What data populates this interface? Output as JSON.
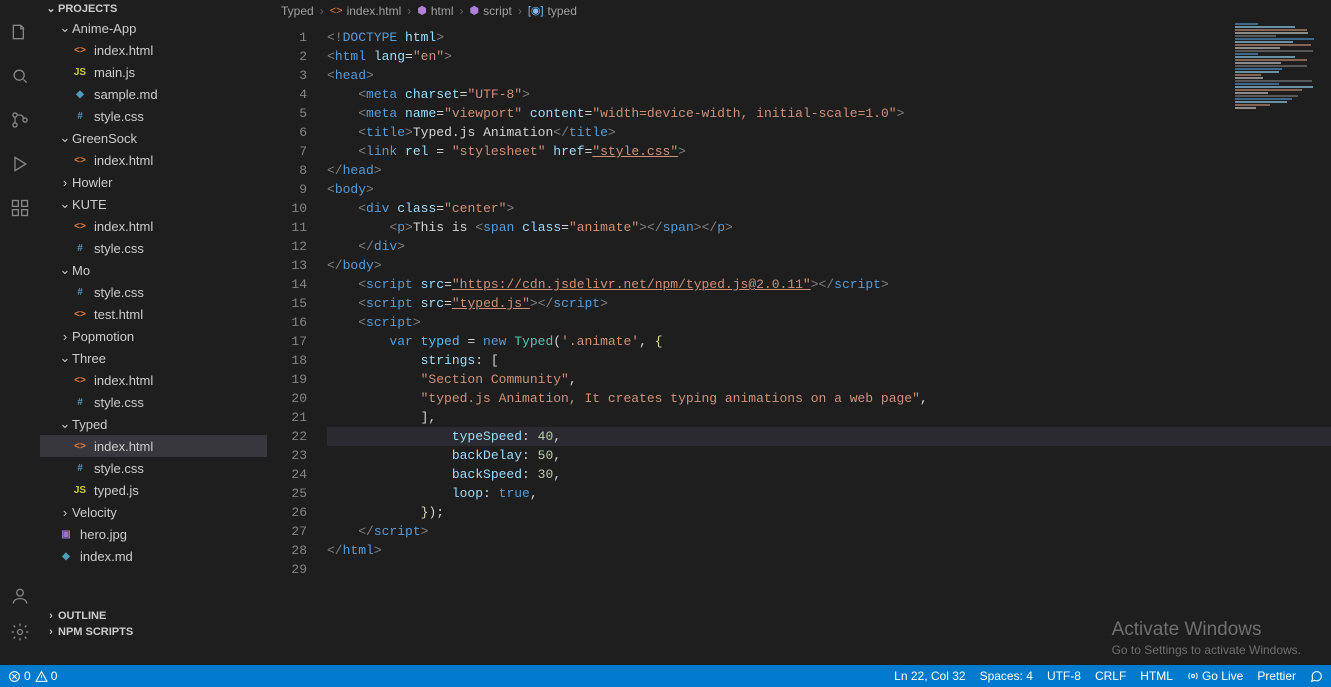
{
  "sidebar": {
    "projects_label": "PROJECTS",
    "folders": [
      {
        "name": "Anime-App",
        "expanded": true,
        "files": [
          {
            "name": "index.html",
            "type": "html"
          },
          {
            "name": "main.js",
            "type": "js"
          },
          {
            "name": "sample.md",
            "type": "md"
          },
          {
            "name": "style.css",
            "type": "css"
          }
        ]
      },
      {
        "name": "GreenSock",
        "expanded": true,
        "files": [
          {
            "name": "index.html",
            "type": "html"
          }
        ]
      },
      {
        "name": "Howler",
        "expanded": false,
        "files": []
      },
      {
        "name": "KUTE",
        "expanded": true,
        "files": [
          {
            "name": "index.html",
            "type": "html"
          },
          {
            "name": "style.css",
            "type": "css"
          }
        ]
      },
      {
        "name": "Mo",
        "expanded": true,
        "files": [
          {
            "name": "style.css",
            "type": "css"
          },
          {
            "name": "test.html",
            "type": "html"
          }
        ]
      },
      {
        "name": "Popmotion",
        "expanded": false,
        "files": []
      },
      {
        "name": "Three",
        "expanded": true,
        "files": [
          {
            "name": "index.html",
            "type": "html"
          },
          {
            "name": "style.css",
            "type": "css"
          }
        ]
      },
      {
        "name": "Typed",
        "expanded": true,
        "active_file": "index.html",
        "files": [
          {
            "name": "index.html",
            "type": "html"
          },
          {
            "name": "style.css",
            "type": "css"
          },
          {
            "name": "typed.js",
            "type": "js"
          }
        ]
      },
      {
        "name": "Velocity",
        "expanded": false,
        "files": []
      }
    ],
    "root_files": [
      {
        "name": "hero.jpg",
        "type": "img"
      },
      {
        "name": "index.md",
        "type": "md"
      }
    ],
    "outline_label": "OUTLINE",
    "npm_label": "NPM SCRIPTS"
  },
  "breadcrumbs": [
    "Typed",
    "index.html",
    "html",
    "script",
    "typed"
  ],
  "editor": {
    "lines": 29,
    "highlight_line": 22,
    "code": [
      {
        "t": [
          [
            "gray",
            "<!"
          ],
          [
            "blue",
            "DOCTYPE"
          ],
          [
            "lightblue",
            " html"
          ],
          [
            "gray",
            ">"
          ]
        ]
      },
      {
        "t": [
          [
            "gray",
            "<"
          ],
          [
            "blue",
            "html"
          ],
          [
            "lightblue",
            " lang"
          ],
          [
            "white",
            "="
          ],
          [
            "string",
            "\"en\""
          ],
          [
            "gray",
            ">"
          ]
        ]
      },
      {
        "t": [
          [
            "gray",
            "<"
          ],
          [
            "blue",
            "head"
          ],
          [
            "gray",
            ">"
          ]
        ]
      },
      {
        "i": 1,
        "t": [
          [
            "gray",
            "<"
          ],
          [
            "blue",
            "meta"
          ],
          [
            "lightblue",
            " charset"
          ],
          [
            "white",
            "="
          ],
          [
            "string",
            "\"UTF-8\""
          ],
          [
            "gray",
            ">"
          ]
        ]
      },
      {
        "i": 1,
        "t": [
          [
            "gray",
            "<"
          ],
          [
            "blue",
            "meta"
          ],
          [
            "lightblue",
            " name"
          ],
          [
            "white",
            "="
          ],
          [
            "string",
            "\"viewport\""
          ],
          [
            "lightblue",
            " content"
          ],
          [
            "white",
            "="
          ],
          [
            "string",
            "\"width=device-width, initial-scale=1.0\""
          ],
          [
            "gray",
            ">"
          ]
        ]
      },
      {
        "i": 1,
        "t": [
          [
            "gray",
            "<"
          ],
          [
            "blue",
            "title"
          ],
          [
            "gray",
            ">"
          ],
          [
            "white",
            "Typed.js Animation"
          ],
          [
            "gray",
            "</"
          ],
          [
            "blue",
            "title"
          ],
          [
            "gray",
            ">"
          ]
        ]
      },
      {
        "i": 1,
        "t": [
          [
            "gray",
            "<"
          ],
          [
            "blue",
            "link"
          ],
          [
            "lightblue",
            " rel"
          ],
          [
            "white",
            " = "
          ],
          [
            "string",
            "\"stylesheet\""
          ],
          [
            "lightblue",
            " href"
          ],
          [
            "white",
            "="
          ],
          [
            "link",
            "\"style.css\""
          ],
          [
            "gray",
            ">"
          ]
        ]
      },
      {
        "t": [
          [
            "gray",
            "</"
          ],
          [
            "blue",
            "head"
          ],
          [
            "gray",
            ">"
          ]
        ]
      },
      {
        "t": [
          [
            "gray",
            "<"
          ],
          [
            "blue",
            "body"
          ],
          [
            "gray",
            ">"
          ]
        ]
      },
      {
        "i": 1,
        "t": [
          [
            "gray",
            "<"
          ],
          [
            "blue",
            "div"
          ],
          [
            "lightblue",
            " class"
          ],
          [
            "white",
            "="
          ],
          [
            "string",
            "\"center\""
          ],
          [
            "gray",
            ">"
          ]
        ]
      },
      {
        "i": 2,
        "t": [
          [
            "gray",
            "<"
          ],
          [
            "blue",
            "p"
          ],
          [
            "gray",
            ">"
          ],
          [
            "white",
            "This is "
          ],
          [
            "gray",
            "<"
          ],
          [
            "blue",
            "span"
          ],
          [
            "lightblue",
            " class"
          ],
          [
            "white",
            "="
          ],
          [
            "string",
            "\"animate\""
          ],
          [
            "gray",
            "></"
          ],
          [
            "blue",
            "span"
          ],
          [
            "gray",
            "></"
          ],
          [
            "blue",
            "p"
          ],
          [
            "gray",
            ">"
          ]
        ]
      },
      {
        "i": 1,
        "t": [
          [
            "gray",
            "</"
          ],
          [
            "blue",
            "div"
          ],
          [
            "gray",
            ">"
          ]
        ]
      },
      {
        "t": [
          [
            "gray",
            "</"
          ],
          [
            "blue",
            "body"
          ],
          [
            "gray",
            ">"
          ]
        ]
      },
      {
        "i": 1,
        "t": [
          [
            "gray",
            "<"
          ],
          [
            "blue",
            "script"
          ],
          [
            "lightblue",
            " src"
          ],
          [
            "white",
            "="
          ],
          [
            "link",
            "\"https://cdn.jsdelivr.net/npm/typed.js@2.0.11\""
          ],
          [
            "gray",
            "></"
          ],
          [
            "blue",
            "script"
          ],
          [
            "gray",
            ">"
          ]
        ]
      },
      {
        "i": 1,
        "t": [
          [
            "gray",
            "<"
          ],
          [
            "blue",
            "script"
          ],
          [
            "lightblue",
            " src"
          ],
          [
            "white",
            "="
          ],
          [
            "link",
            "\"typed.js\""
          ],
          [
            "gray",
            "></"
          ],
          [
            "blue",
            "script"
          ],
          [
            "gray",
            ">"
          ]
        ]
      },
      {
        "i": 1,
        "t": [
          [
            "gray",
            "<"
          ],
          [
            "blue",
            "script"
          ],
          [
            "gray",
            ">"
          ]
        ]
      },
      {
        "i": 2,
        "t": [
          [
            "blue",
            "var"
          ],
          [
            "var",
            " typed"
          ],
          [
            "white",
            " = "
          ],
          [
            "blue",
            "new"
          ],
          [
            "green",
            " Typed"
          ],
          [
            "white",
            "("
          ],
          [
            "string",
            "'.animate'"
          ],
          [
            "white",
            ", "
          ],
          [
            "dyellow",
            "{"
          ]
        ]
      },
      {
        "i": 3,
        "t": [
          [
            "lightblue",
            "strings"
          ],
          [
            "white",
            ": "
          ],
          [
            "white",
            "["
          ]
        ]
      },
      {
        "i": 3,
        "t": [
          [
            "string",
            "\"Section Community\""
          ],
          [
            "white",
            ","
          ]
        ]
      },
      {
        "i": 3,
        "t": [
          [
            "string",
            "\"typed.js Animation, It creates typing animations on a web page\""
          ],
          [
            "white",
            ","
          ]
        ]
      },
      {
        "i": 3,
        "t": [
          [
            "white",
            "],"
          ]
        ]
      },
      {
        "i": 4,
        "t": [
          [
            "lightblue",
            "typeSpeed"
          ],
          [
            "white",
            ": "
          ],
          [
            "num",
            "40"
          ],
          [
            "white",
            ","
          ]
        ]
      },
      {
        "i": 4,
        "t": [
          [
            "lightblue",
            "backDelay"
          ],
          [
            "white",
            ": "
          ],
          [
            "num",
            "50"
          ],
          [
            "white",
            ","
          ]
        ]
      },
      {
        "i": 4,
        "t": [
          [
            "lightblue",
            "backSpeed"
          ],
          [
            "white",
            ": "
          ],
          [
            "num",
            "30"
          ],
          [
            "white",
            ","
          ]
        ]
      },
      {
        "i": 4,
        "t": [
          [
            "lightblue",
            "loop"
          ],
          [
            "white",
            ": "
          ],
          [
            "blue",
            "true"
          ],
          [
            "white",
            ","
          ]
        ]
      },
      {
        "i": 3,
        "t": [
          [
            "dyellow",
            "}"
          ],
          [
            "white",
            ");"
          ]
        ]
      },
      {
        "i": 1,
        "t": [
          [
            "gray",
            "</"
          ],
          [
            "blue",
            "script"
          ],
          [
            "gray",
            ">"
          ]
        ]
      },
      {
        "t": [
          [
            "gray",
            "</"
          ],
          [
            "blue",
            "html"
          ],
          [
            "gray",
            ">"
          ]
        ]
      },
      {
        "t": []
      }
    ]
  },
  "overlay": {
    "title": "Activate Windows",
    "sub": "Go to Settings to activate Windows."
  },
  "status": {
    "errors": "0",
    "warnings": "0",
    "lncol": "Ln 22, Col 32",
    "spaces": "Spaces: 4",
    "encoding": "UTF-8",
    "eol": "CRLF",
    "lang": "HTML",
    "golive": "Go Live",
    "prettier": "Prettier"
  }
}
